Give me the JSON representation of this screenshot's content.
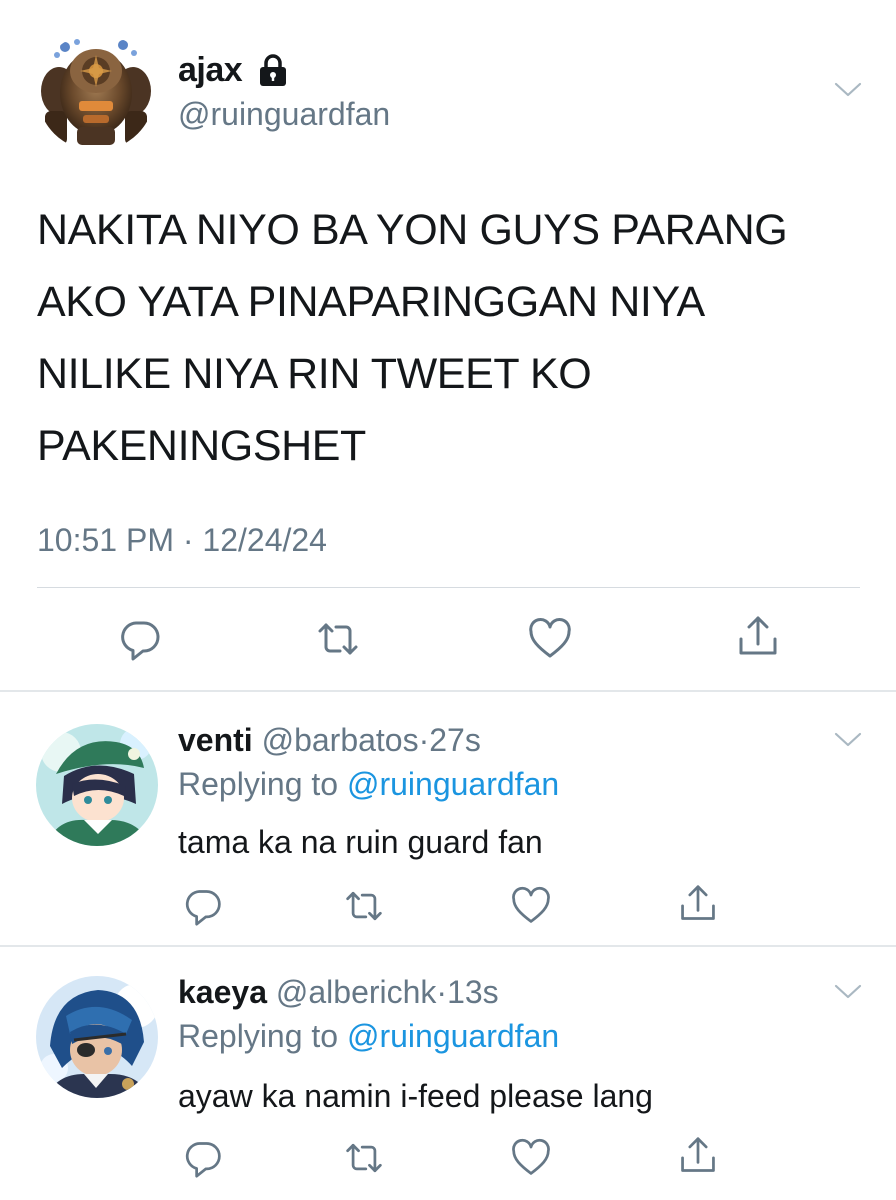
{
  "main_tweet": {
    "display_name": "ajax",
    "handle": "@ruinguardfan",
    "text": "NAKITA NIYO BA YON GUYS PARANG\nAKO YATA PINAPARINGGAN NIYA\nNILIKE NIYA RIN TWEET KO\nPAKENINGSHET",
    "time": "10:51 PM",
    "separator": " · ",
    "date": "12/24/24",
    "icons": {
      "avatar": "ruin-guard-avatar",
      "lock": "lock-icon",
      "menu": "chevron-down-icon",
      "reply": "reply-icon",
      "retweet": "retweet-icon",
      "like": "heart-icon",
      "share": "share-icon"
    }
  },
  "replies": [
    {
      "display_name": "venti",
      "handle": "@barbatos",
      "dot": "·",
      "age": "27s",
      "replying_label": "Replying to",
      "replying_to": "@ruinguardfan",
      "text": "tama ka na ruin guard fan"
    },
    {
      "display_name": "kaeya",
      "handle": "@alberichk",
      "dot": "·",
      "age": "13s",
      "replying_label": "Replying to",
      "replying_to": "@ruinguardfan",
      "text": "ayaw ka namin i-feed please lang"
    }
  ],
  "colors": {
    "text": "#14171a",
    "secondary": "#657786",
    "link": "#1b95e0",
    "divider": "#e3e7ea",
    "icon": "#657786"
  }
}
